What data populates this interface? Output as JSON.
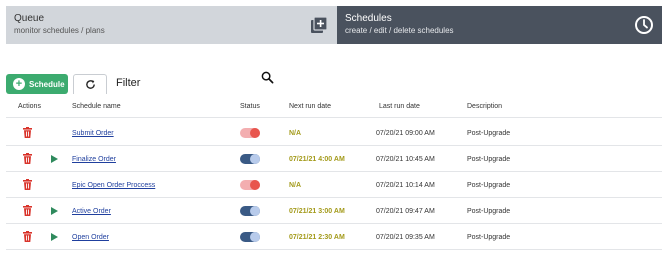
{
  "panels": {
    "queue": {
      "title": "Queue",
      "subtitle": "monitor schedules / plans",
      "icon": "add-to-queue-icon"
    },
    "schedules": {
      "title": "Schedules",
      "subtitle": "create / edit / delete schedules",
      "icon": "clock-icon"
    }
  },
  "toolbar": {
    "schedule_label": "Schedule",
    "filter_placeholder": "Filter"
  },
  "table": {
    "headers": {
      "actions": "Actions",
      "name": "Schedule name",
      "status": "Status",
      "next": "Next run date",
      "last": "Last run date",
      "desc": "Description"
    },
    "rows": [
      {
        "name": "Submit Order",
        "status": "off",
        "next": "N/A",
        "last": "07/20/21 09:00 AM",
        "desc": "Post-Upgrade",
        "can_run": false
      },
      {
        "name": "Finalize Order",
        "status": "on",
        "next": "07/21/21 4:00 AM",
        "last": "07/20/21 10:45 AM",
        "desc": "Post-Upgrade",
        "can_run": true
      },
      {
        "name": "Epic Open Order Proccess",
        "status": "off",
        "next": "N/A",
        "last": "07/20/21 10:14 AM",
        "desc": "Post-Upgrade",
        "can_run": false
      },
      {
        "name": "Active Order",
        "status": "on",
        "next": "07/21/21 3:00 AM",
        "last": "07/20/21 09:47 AM",
        "desc": "Post-Upgrade",
        "can_run": true
      },
      {
        "name": "Open Order",
        "status": "on",
        "next": "07/21/21 2:30 AM",
        "last": "07/20/21 09:35 AM",
        "desc": "Post-Upgrade",
        "can_run": true
      }
    ]
  },
  "colors": {
    "accent_green": "#3cab6f",
    "link_blue": "#1f3f9e",
    "next_run_olive": "#a39a1a",
    "trash_red": "#d9342b",
    "play_green": "#2f8a5d"
  }
}
